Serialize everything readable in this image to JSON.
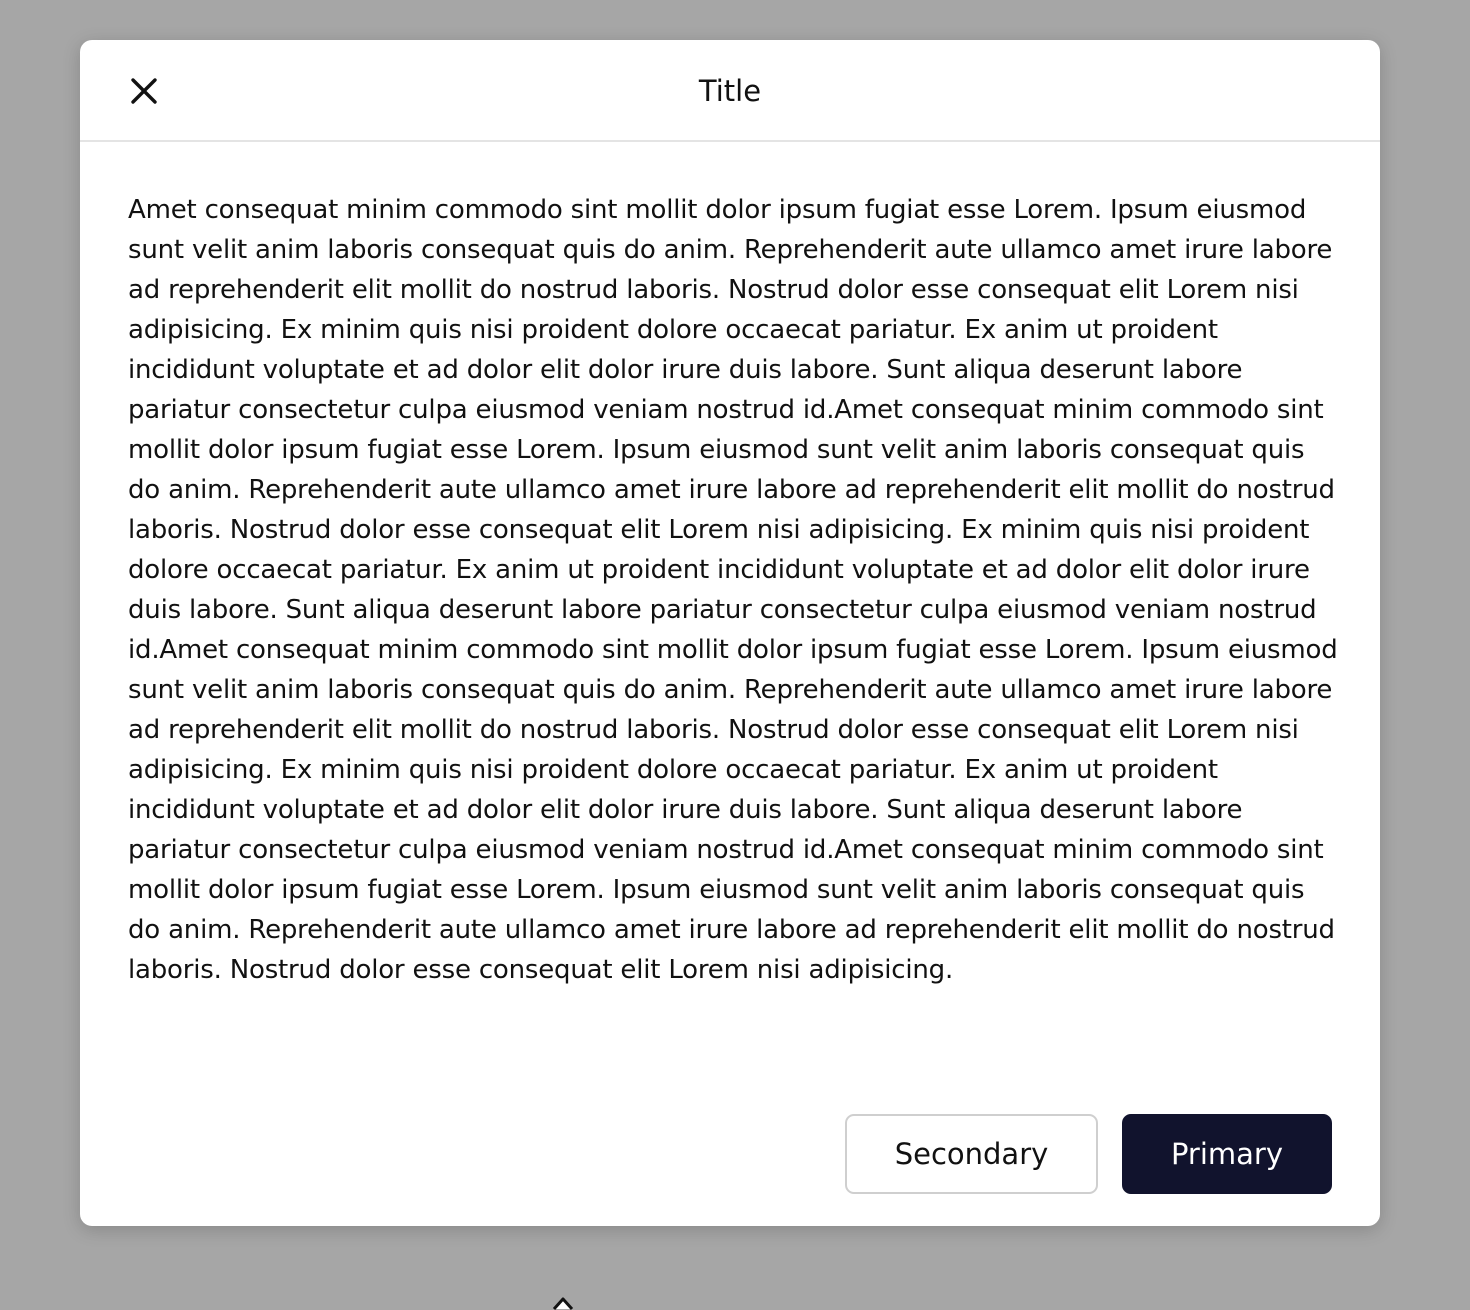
{
  "modal": {
    "title": "Title",
    "close_icon": "close-icon",
    "body_text": "Amet consequat minim commodo sint mollit dolor ipsum fugiat esse Lorem. Ipsum eiusmod sunt velit anim laboris consequat quis do anim. Reprehenderit aute ullamco amet irure labore ad reprehenderit elit mollit do nostrud laboris. Nostrud dolor esse consequat elit Lorem nisi adipisicing. Ex minim quis nisi proident dolore occaecat pariatur. Ex anim ut proident incididunt voluptate et ad dolor elit dolor irure duis labore. Sunt aliqua deserunt labore pariatur consectetur culpa eiusmod veniam nostrud id.Amet consequat minim commodo sint mollit dolor ipsum fugiat esse Lorem. Ipsum eiusmod sunt velit anim laboris consequat quis do anim. Reprehenderit aute ullamco amet irure labore ad reprehenderit elit mollit do nostrud laboris. Nostrud dolor esse consequat elit Lorem nisi adipisicing. Ex minim quis nisi proident dolore occaecat pariatur. Ex anim ut proident incididunt voluptate et ad dolor elit dolor irure duis labore. Sunt aliqua deserunt labore pariatur consectetur culpa eiusmod veniam nostrud id.Amet consequat minim commodo sint mollit dolor ipsum fugiat esse Lorem. Ipsum eiusmod sunt velit anim laboris consequat quis do anim. Reprehenderit aute ullamco amet irure labore ad reprehenderit elit mollit do nostrud laboris. Nostrud dolor esse consequat elit Lorem nisi adipisicing. Ex minim quis nisi proident dolore occaecat pariatur. Ex anim ut proident incididunt voluptate et ad dolor elit dolor irure duis labore. Sunt aliqua deserunt labore pariatur consectetur culpa eiusmod veniam nostrud id.Amet consequat minim commodo sint mollit dolor ipsum fugiat esse Lorem. Ipsum eiusmod sunt velit anim laboris consequat quis do anim. Reprehenderit aute ullamco amet irure labore ad reprehenderit elit mollit do nostrud laboris. Nostrud dolor esse consequat elit Lorem nisi adipisicing.",
    "secondary_label": "Secondary",
    "primary_label": "Primary"
  },
  "colors": {
    "backdrop": "#a6a6a6",
    "surface": "#ffffff",
    "text": "#111111",
    "primary_bg": "#11132d",
    "secondary_border": "#cfcfcf",
    "divider": "#e4e4e4"
  }
}
